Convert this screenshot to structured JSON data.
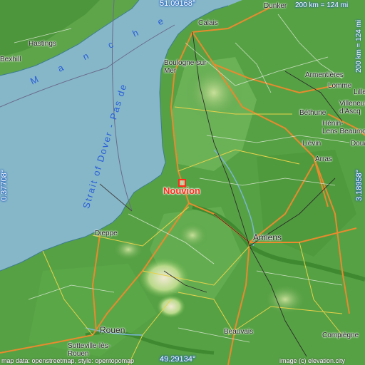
{
  "map": {
    "place": "Nouvion",
    "lat_top": "51.09168°",
    "lat_bottom": "49.29134°",
    "lon_left": "0.37708°",
    "lon_right": "3.18958°",
    "scale": "200 km = 124 mi",
    "credit_left": "map data: openstreetmap, style: opentopomap",
    "credit_right": "image (c) elevation.city",
    "sea": {
      "strait": "Strait of Dover - Pas de",
      "manche": "M a n c h e"
    },
    "cities": [
      {
        "id": "calais",
        "name": "Calais"
      },
      {
        "id": "dunkerque",
        "name": "Dunker"
      },
      {
        "id": "boulogne",
        "name": "Boulogne-sur-\nMer"
      },
      {
        "id": "hastings",
        "name": "Hastings"
      },
      {
        "id": "bexhill",
        "name": "Bexhill"
      },
      {
        "id": "armentieres",
        "name": "Armentières"
      },
      {
        "id": "lomme",
        "name": "Lomme"
      },
      {
        "id": "lille",
        "name": "Lille"
      },
      {
        "id": "villeneuve",
        "name": "Villeneuv\nd'Ascq"
      },
      {
        "id": "bethune",
        "name": "Béthune"
      },
      {
        "id": "henin",
        "name": "Hénin-\nLens Beaumon"
      },
      {
        "id": "lievin",
        "name": "Liévin"
      },
      {
        "id": "douai",
        "name": "Doua"
      },
      {
        "id": "arras",
        "name": "Arras"
      },
      {
        "id": "amiens",
        "name": "Amiens"
      },
      {
        "id": "dieppe",
        "name": "Dieppe"
      },
      {
        "id": "rouen",
        "name": "Rouen"
      },
      {
        "id": "sotteville",
        "name": "Sotteville-lès-\nRouen"
      },
      {
        "id": "beauvais",
        "name": "Beauvais"
      },
      {
        "id": "compiegne",
        "name": "Compiègne"
      }
    ]
  }
}
